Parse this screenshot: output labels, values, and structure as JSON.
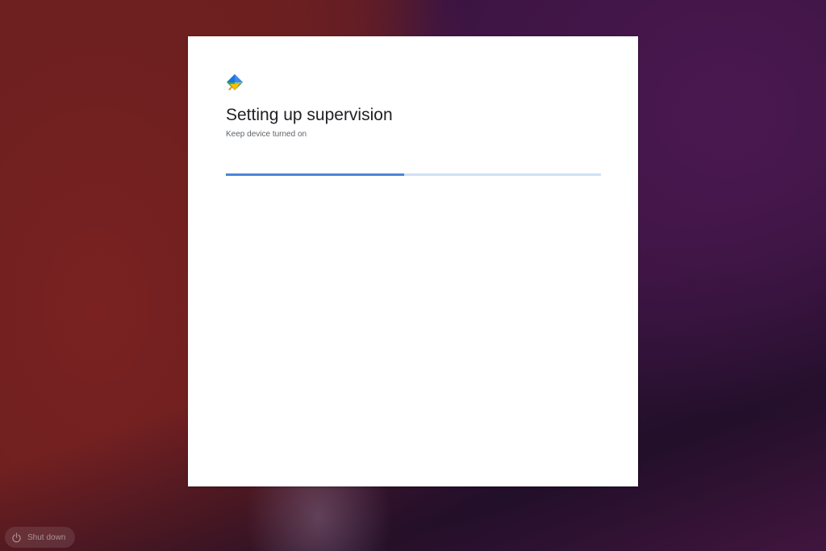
{
  "dialog": {
    "logo_icon": "family-link-logo-icon",
    "title": "Setting up supervision",
    "subtitle": "Keep device turned on",
    "progress": {
      "fraction": 0.475,
      "fill_color": "#4a86d8",
      "track_color": "#cfe0f6"
    }
  },
  "shelf": {
    "shutdown_button": {
      "label": "Shut down",
      "icon": "power-icon"
    }
  },
  "colors": {
    "wallpaper_red": "#6e1f1f",
    "wallpaper_purple": "#3a1440",
    "dialog_background": "#ffffff"
  }
}
